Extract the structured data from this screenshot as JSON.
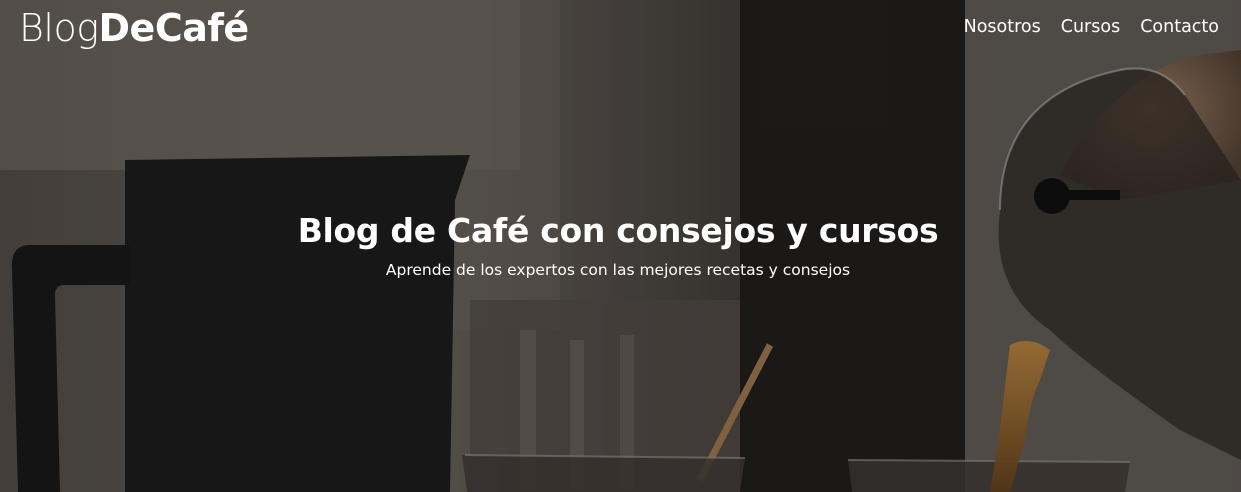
{
  "header": {
    "logo_part1": "Blog",
    "logo_part2": "DeCafé",
    "nav": [
      "Nosotros",
      "Cursos",
      "Contacto"
    ]
  },
  "hero": {
    "title": "Blog de Café con consejos y cursos",
    "subtitle": "Aprende de los expertos con las mejores recetas y consejos"
  },
  "colors": {
    "text": "#ffffff",
    "overlay": "#000000"
  }
}
